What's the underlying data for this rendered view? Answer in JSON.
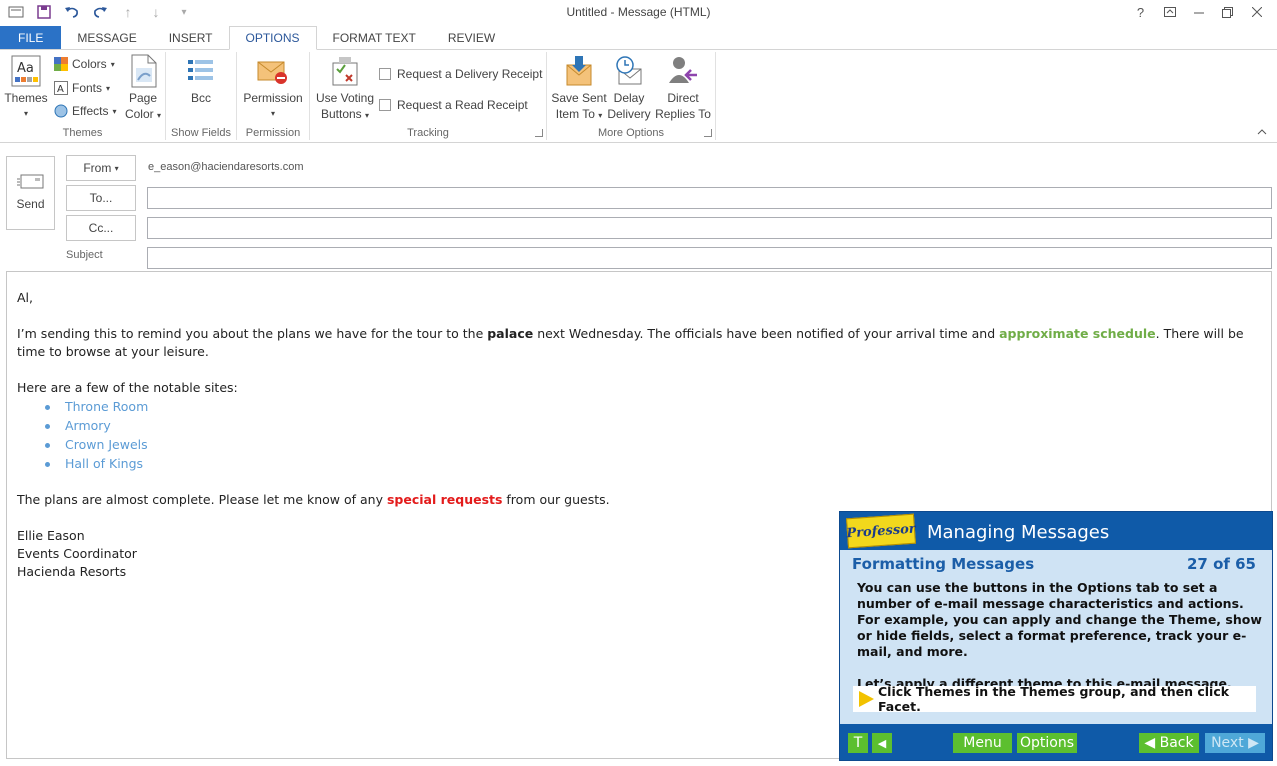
{
  "window": {
    "title": "Untitled - Message (HTML)",
    "controls": [
      "?",
      "ribbon-display-icon",
      "minimize-icon",
      "restore-icon",
      "close-icon"
    ]
  },
  "qat": [
    "mail-icon",
    "save-icon",
    "undo-icon",
    "redo-icon",
    "up-arrow-icon",
    "down-arrow-icon",
    "customize-icon"
  ],
  "tabs": [
    {
      "label": "FILE"
    },
    {
      "label": "MESSAGE"
    },
    {
      "label": "INSERT"
    },
    {
      "label": "OPTIONS"
    },
    {
      "label": "FORMAT TEXT"
    },
    {
      "label": "REVIEW"
    }
  ],
  "ribbon": {
    "themes": {
      "themes_btn": "Themes",
      "colors": "Colors",
      "fonts": "Fonts",
      "effects": "Effects",
      "page_color_line1": "Page",
      "page_color_line2": "Color",
      "label": "Themes"
    },
    "show_fields": {
      "bcc": "Bcc",
      "label": "Show Fields"
    },
    "permission": {
      "btn": "Permission",
      "label": "Permission"
    },
    "tracking": {
      "voting_line1": "Use Voting",
      "voting_line2": "Buttons",
      "delivery_receipt": "Request a Delivery Receipt",
      "read_receipt": "Request a Read Receipt",
      "label": "Tracking"
    },
    "more_options": {
      "save_sent_line1": "Save Sent",
      "save_sent_line2": "Item To",
      "delay_line1": "Delay",
      "delay_line2": "Delivery",
      "direct_line1": "Direct",
      "direct_line2": "Replies To",
      "label": "More Options"
    }
  },
  "header": {
    "send": "Send",
    "from_btn": "From",
    "from_address": "e_eason@haciendaresorts.com",
    "to_btn": "To...",
    "cc_btn": "Cc...",
    "subject_label": "Subject",
    "to_value": "",
    "cc_value": "",
    "subject_value": ""
  },
  "body": {
    "greeting": "Al,",
    "p1_a": "I’m sending this to remind you about the plans we have for the tour to the ",
    "p1_b": "palace",
    "p1_c": " next Wednesday. The officials have been notified of your arrival time and ",
    "p1_d": "approximate schedule",
    "p1_e": ". There will be time to browse at your leisure.",
    "p2": "Here are a few of the notable sites:",
    "sites": [
      "Throne Room",
      "Armory",
      "Crown Jewels",
      "Hall of Kings"
    ],
    "p3_a": "The plans are almost complete. Please let me know of any ",
    "p3_b": "special requests",
    "p3_c": " from our guests.",
    "sig": [
      "Ellie Eason",
      "Events Coordinator",
      "Hacienda Resorts"
    ]
  },
  "tutorial": {
    "logo": "Professor teaches",
    "title": "Managing Messages",
    "subtitle": "Formatting Messages",
    "counter": "27 of 65",
    "text1": "You can use the buttons in the Options tab to set a number of e-mail message characteristics and actions. For example, you can apply and change the Theme, show or hide fields, select a format preference, track your e-mail, and more.",
    "text2": "Let’s apply a different theme to this e-mail message.",
    "instruction": "Click Themes in the Themes group, and then click Facet.",
    "buttons": {
      "t": "T",
      "back_arrow": "◀",
      "menu": "Menu",
      "options": "Options",
      "back": "◀ Back",
      "next": "Next ▶"
    },
    "colors": {
      "header": "#0f5aa8",
      "panel": "#cfe3f4",
      "button": "#5cbf2f"
    }
  }
}
